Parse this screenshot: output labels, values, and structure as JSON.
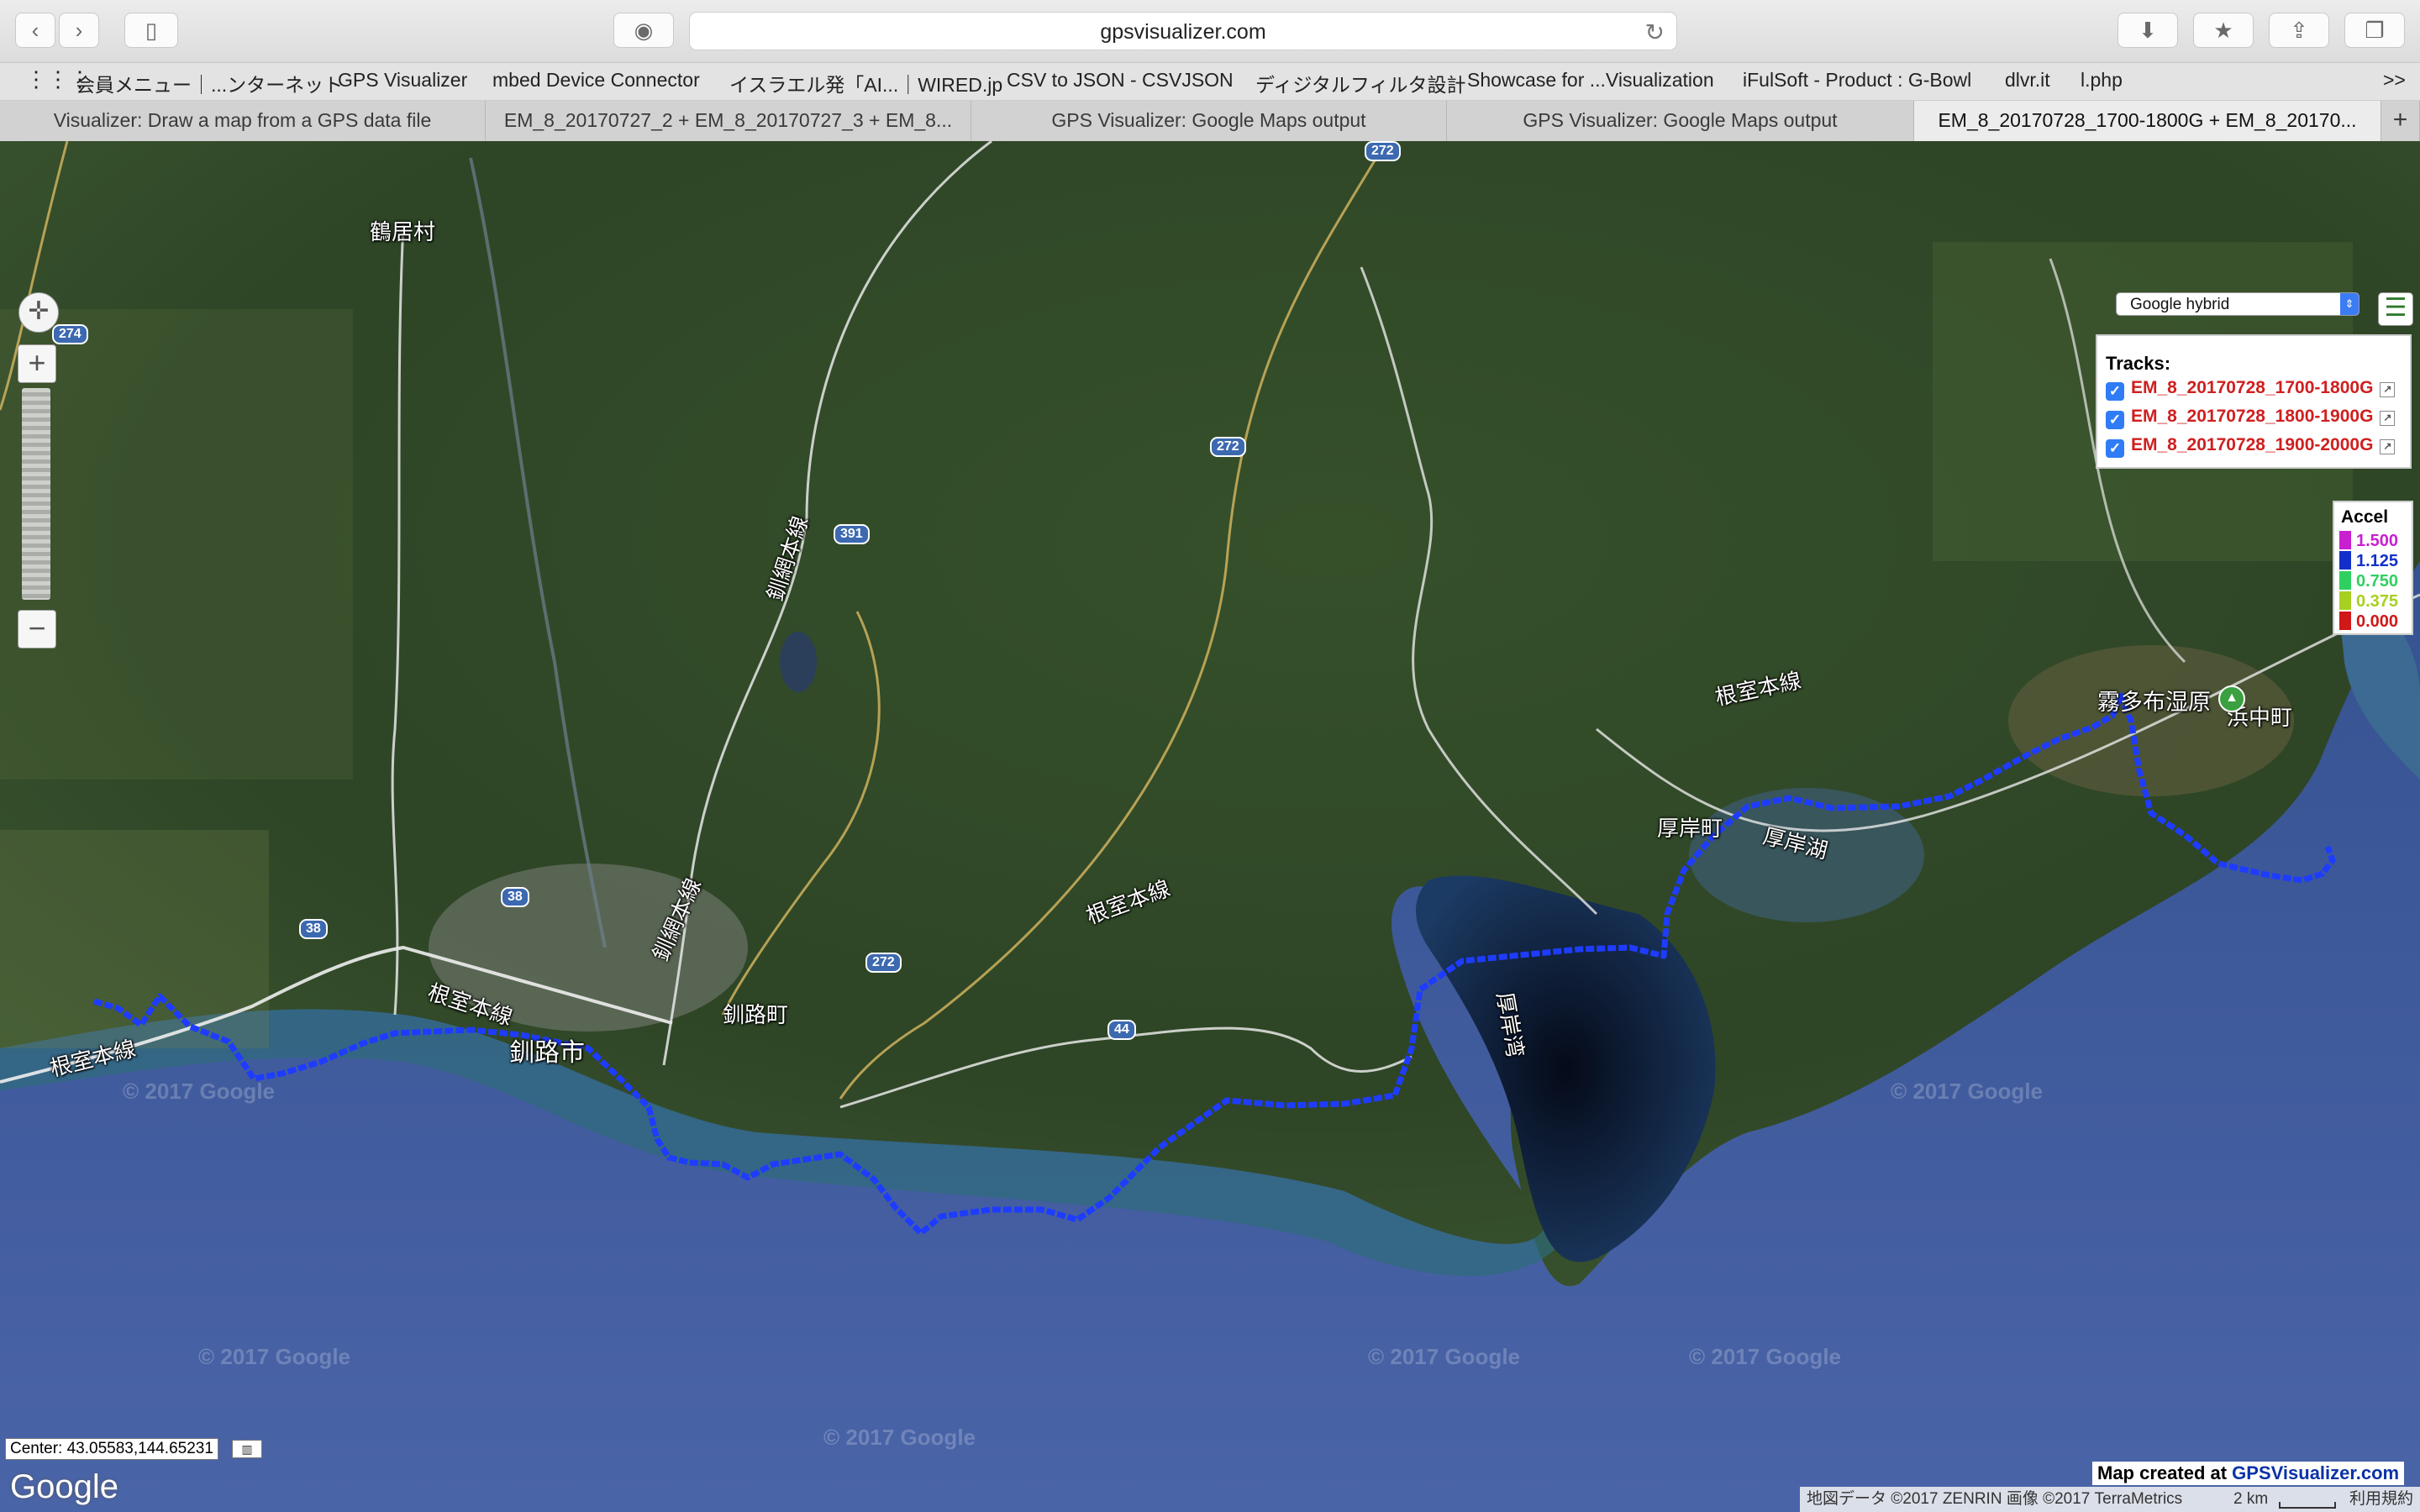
{
  "browser": {
    "url": "gpsvisualizer.com",
    "bookmarks": [
      "会員メニュー｜...ンターネット",
      "GPS Visualizer",
      "mbed Device Connector",
      "イスラエル発「AI...｜WIRED.jp",
      "CSV to JSON - CSVJSON",
      "ディジタルフィルタ設計",
      "Showcase for ...Visualization",
      "iFulSoft - Product : G-Bowl",
      "dlvr.it",
      "l.php"
    ],
    "tabs": [
      "Visualizer: Draw a map from a GPS data file",
      "EM_8_20170727_2 + EM_8_20170727_3 + EM_8...",
      "GPS Visualizer: Google Maps output",
      "GPS Visualizer: Google Maps output",
      "EM_8_20170728_1700-1800G + EM_8_20170..."
    ],
    "new_tab": "+",
    "overflow": ">>"
  },
  "map": {
    "type_select": "Google hybrid",
    "tracks_title": "Tracks:",
    "tracks": [
      "EM_8_20170728_1700-1800G",
      "EM_8_20170728_1800-1900G",
      "EM_8_20170728_1900-2000G"
    ],
    "accel_title": "Accel",
    "accel_legend": [
      {
        "value": "1.500",
        "color": "#c81fd0"
      },
      {
        "value": "1.125",
        "color": "#1230c8"
      },
      {
        "value": "0.750",
        "color": "#30d060"
      },
      {
        "value": "0.375",
        "color": "#a8d020"
      },
      {
        "value": "0.000",
        "color": "#d01818"
      }
    ],
    "place_labels": [
      "鶴居村",
      "釧網本線",
      "根室本線",
      "根室本線",
      "根室本線",
      "根室本線",
      "釧路町",
      "釧路市",
      "厚岸町",
      "厚岸湖",
      "厚岸湾",
      "霧多布湿原",
      "浜中町",
      "釧網本線"
    ],
    "road_shields": [
      "272",
      "272",
      "272",
      "274",
      "391",
      "44",
      "38",
      "38"
    ],
    "watermark": "© 2017 Google",
    "center": "Center: 43.05583,144.65231",
    "google_logo": "Google",
    "credit_prefix": "Map created at ",
    "credit_link": "GPSVisualizer.com",
    "attribution": "地図データ ©2017 ZENRIN 画像 ©2017 TerraMetrics",
    "scale": "2 km",
    "terms": "利用規約"
  },
  "colors": {
    "track": "#1e3cff",
    "track_text": "#d01f1f",
    "accent": "#2f7cf6"
  }
}
